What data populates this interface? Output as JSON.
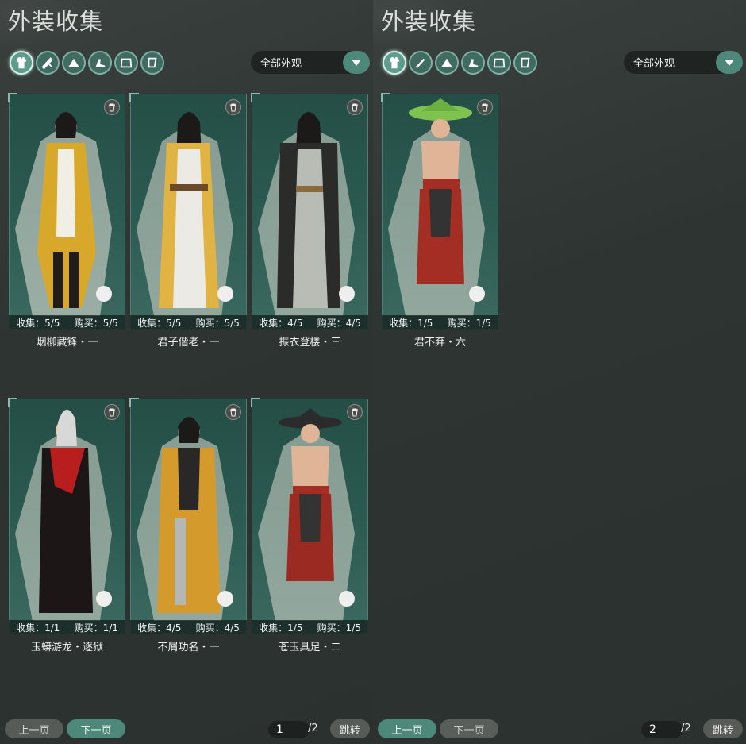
{
  "left": {
    "title": "外装收集",
    "filters": [
      "outfit-icon",
      "weapon-icon",
      "hat-icon",
      "bag-icon",
      "cloak-icon",
      "pendant-icon"
    ],
    "dropdown": "全部外观",
    "cards": [
      {
        "name": "烟柳藏锋・一",
        "collect": "收集：5/5",
        "buy": "购买：5/5",
        "palette": "#d8a82b"
      },
      {
        "name": "君子偕老・一",
        "collect": "收集：5/5",
        "buy": "购买：5/5",
        "palette": "#e0b343"
      },
      {
        "name": "振衣登楼・三",
        "collect": "收集：4/5",
        "buy": "购买：4/5",
        "palette": "#8d8f86"
      },
      {
        "name": "玉蟒游龙・逐狱",
        "collect": "收集：1/1",
        "buy": "购买：1/1",
        "palette": "#2a1c1c"
      },
      {
        "name": "不屑功名・一",
        "collect": "收集：4/5",
        "buy": "购买：4/5",
        "palette": "#d59a2c"
      },
      {
        "name": "苍玉具足・二",
        "collect": "收集：1/5",
        "buy": "购买：1/5",
        "palette": "#9b2a22"
      }
    ],
    "pager": {
      "prev": "上一页",
      "next": "下一页",
      "page": "1",
      "total": "/2",
      "jump": "跳转"
    }
  },
  "right": {
    "title": "外装收集",
    "filters": [
      "outfit-icon",
      "weapon-icon",
      "hat-icon",
      "bag-icon",
      "cloak-icon",
      "pendant-icon"
    ],
    "dropdown": "全部外观",
    "cards": [
      {
        "name": "君不弃・六",
        "collect": "收集：1/5",
        "buy": "购买：1/5",
        "palette": "#a52e24"
      }
    ],
    "pager": {
      "prev": "上一页",
      "next": "下一页",
      "page": "2",
      "total": "/2",
      "jump": "跳转"
    }
  }
}
